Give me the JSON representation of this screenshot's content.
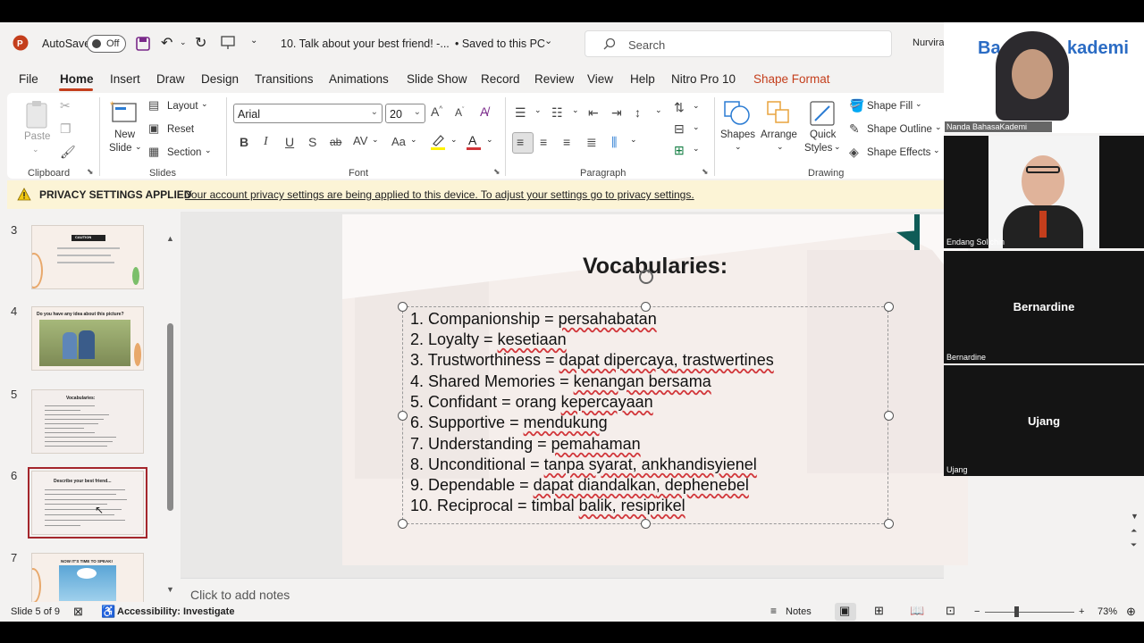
{
  "titlebar": {
    "autosave_label": "AutoSave",
    "autosave_state": "Off",
    "filename": "10. Talk about your best friend! -...",
    "save_status": "• Saved to this PC",
    "search_placeholder": "Search",
    "user": "Nurvira"
  },
  "menu": [
    "File",
    "Home",
    "Insert",
    "Draw",
    "Design",
    "Transitions",
    "Animations",
    "Slide Show",
    "Record",
    "Review",
    "View",
    "Help",
    "Nitro Pro 10",
    "Shape Format"
  ],
  "ribbon": {
    "clipboard": {
      "paste": "Paste",
      "group": "Clipboard"
    },
    "slides": {
      "new_slide": "New",
      "new_slide2": "Slide",
      "layout": "Layout",
      "reset": "Reset",
      "section": "Section",
      "group": "Slides"
    },
    "font": {
      "family": "Arial",
      "size": "20",
      "group": "Font"
    },
    "paragraph": {
      "group": "Paragraph"
    },
    "drawing": {
      "shapes": "Shapes",
      "arrange": "Arrange",
      "quick": "Quick",
      "styles": "Styles",
      "fill": "Shape Fill",
      "outline": "Shape Outline",
      "effects": "Shape Effects",
      "group": "Drawing"
    }
  },
  "privacy": {
    "title": "PRIVACY SETTINGS APPLIED",
    "message": "Your account privacy settings are being applied to this device. To adjust your settings go to privacy settings."
  },
  "thumbnails": [
    {
      "num": "3",
      "title": "CAUTION"
    },
    {
      "num": "4",
      "title": "Do you have any idea about this picture?"
    },
    {
      "num": "5",
      "title": "Vocabularies:"
    },
    {
      "num": "6",
      "title": "Describe your best friend..."
    },
    {
      "num": "7",
      "title": "NOW IT'S TIME TO SPEAK!"
    }
  ],
  "slide": {
    "title": "Vocabularies:",
    "lines": [
      {
        "pre": "1. Companionship = ",
        "word": "persahabatan",
        "rest": ""
      },
      {
        "pre": "2. Loyalty = ",
        "word": "kesetiaan",
        "rest": ""
      },
      {
        "pre": "3. Trustworthiness = ",
        "word": "dapat dipercaya",
        "rest": ", trastwertines"
      },
      {
        "pre": "4. Shared Memories = ",
        "word": "kenangan bersama",
        "rest": ""
      },
      {
        "pre": "5. Confidant = orang ",
        "word": "kepercayaan",
        "rest": ""
      },
      {
        "pre": "6. Supportive = ",
        "word": "mendukung",
        "rest": ""
      },
      {
        "pre": "7. Understanding = ",
        "word": "pemahaman",
        "rest": ""
      },
      {
        "pre": "8. Unconditional = ",
        "word": "tanpa syarat",
        "rest": ", ankhandisyienel"
      },
      {
        "pre": "9. Dependable = ",
        "word": "dapat diandalkan",
        "rest": ", dephenebel"
      },
      {
        "pre": "10. Reciprocal = timbal ",
        "word": "balik",
        "rest": ", resiprikel"
      }
    ]
  },
  "notes_placeholder": "Click to add notes",
  "status": {
    "slide": "Slide 5 of 9",
    "accessibility": "Accessibility: Investigate",
    "notes": "Notes",
    "zoom": "73%"
  },
  "participants": [
    {
      "name": "Nanda BahasaKademi",
      "logo": "Ba",
      "logo2": "kademi"
    },
    {
      "name": "Endang Solichin"
    },
    {
      "name": "Bernardine",
      "display": "Bernardine"
    },
    {
      "name": "Ujang",
      "display": "Ujang"
    }
  ],
  "colors": {
    "accent": "#c43e1c",
    "selected_thumb": "#a4262c",
    "privacy_bg": "#fcf4d6"
  }
}
